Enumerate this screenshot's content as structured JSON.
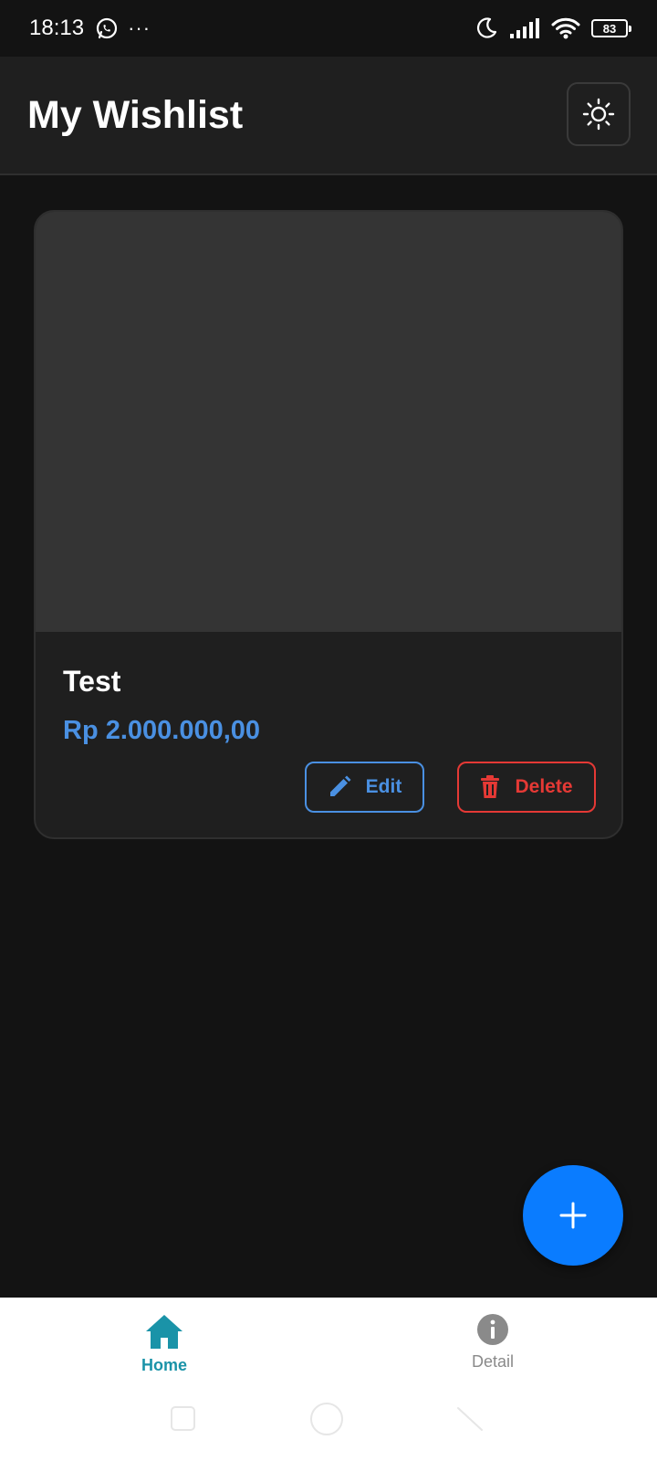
{
  "status_bar": {
    "time": "18:13",
    "more": "···",
    "battery": "83",
    "icons": [
      "whatsapp-icon",
      "moon-icon",
      "signal-icon",
      "wifi-icon",
      "battery-icon"
    ]
  },
  "app_bar": {
    "title": "My Wishlist",
    "theme_icon": "sun-icon"
  },
  "items": [
    {
      "name": "Test",
      "price": "Rp 2.000.000,00",
      "edit_label": "Edit",
      "delete_label": "Delete"
    }
  ],
  "fab": {
    "icon": "plus-icon"
  },
  "bottom_nav": {
    "items": [
      {
        "label": "Home",
        "icon": "home-icon",
        "active": true
      },
      {
        "label": "Detail",
        "icon": "info-icon",
        "active": false
      }
    ]
  },
  "colors": {
    "background": "#131313",
    "app_bar": "#1f1f1f",
    "card": "#1f1f1f",
    "image_placeholder": "#343434",
    "price": "#4a90e2",
    "edit": "#4a90e2",
    "delete": "#e53935",
    "fab": "#0a7cff",
    "nav_active": "#1a93a8",
    "nav_inactive": "#8a8a8a"
  }
}
